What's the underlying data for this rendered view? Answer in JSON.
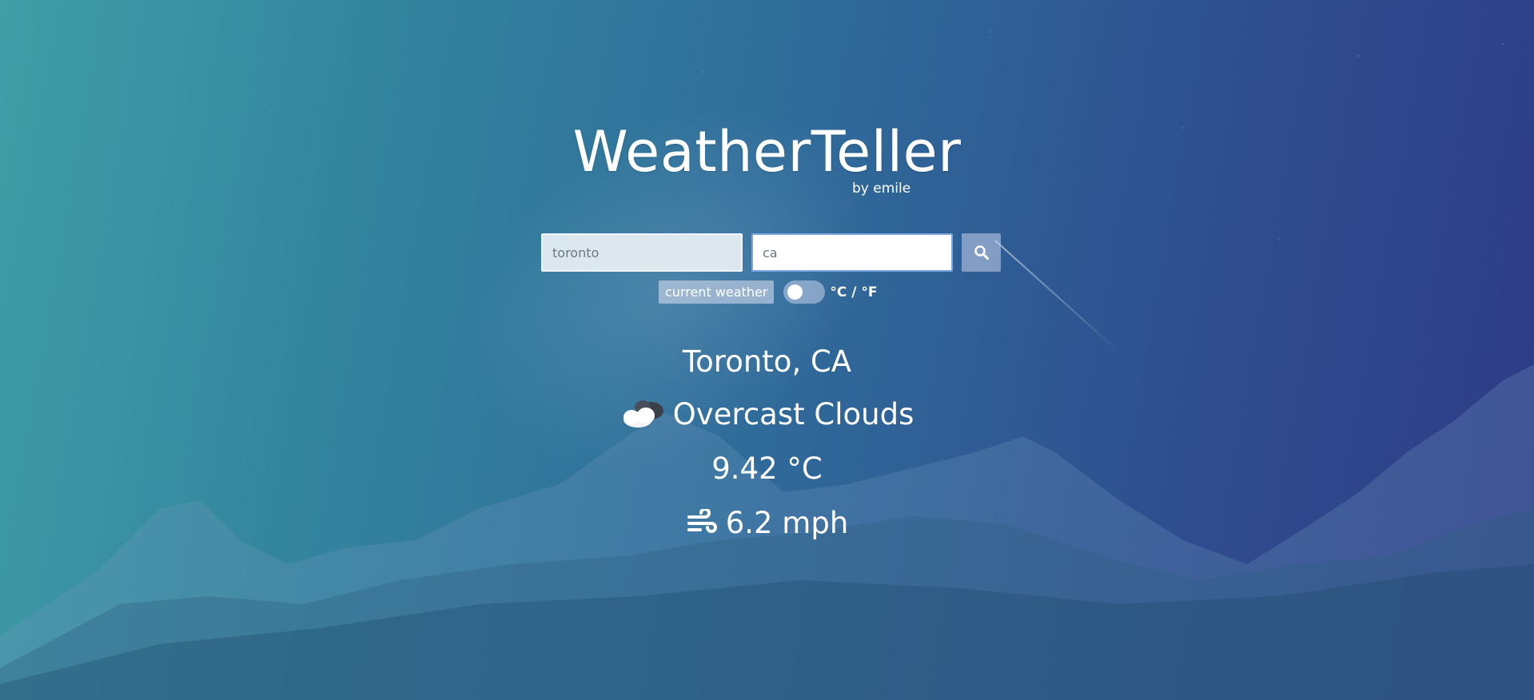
{
  "app": {
    "title": "WeatherTeller",
    "byline": "by emile"
  },
  "search": {
    "city_value": "toronto",
    "country_value": "ca",
    "button_icon": "search-icon"
  },
  "options": {
    "mode_label": "current weather",
    "unit_toggle_label": "°C / °F",
    "unit_toggle_on": false
  },
  "weather": {
    "location": "Toronto, CA",
    "condition_icon": "cloud-icon",
    "condition": "Overcast Clouds",
    "temperature": "9.42 °C",
    "wind_icon": "wind-icon",
    "wind": "6.2 mph"
  },
  "colors": {
    "gradient_start": "#3f9ea6",
    "gradient_end": "#2e3a86",
    "text": "#ffffff"
  }
}
